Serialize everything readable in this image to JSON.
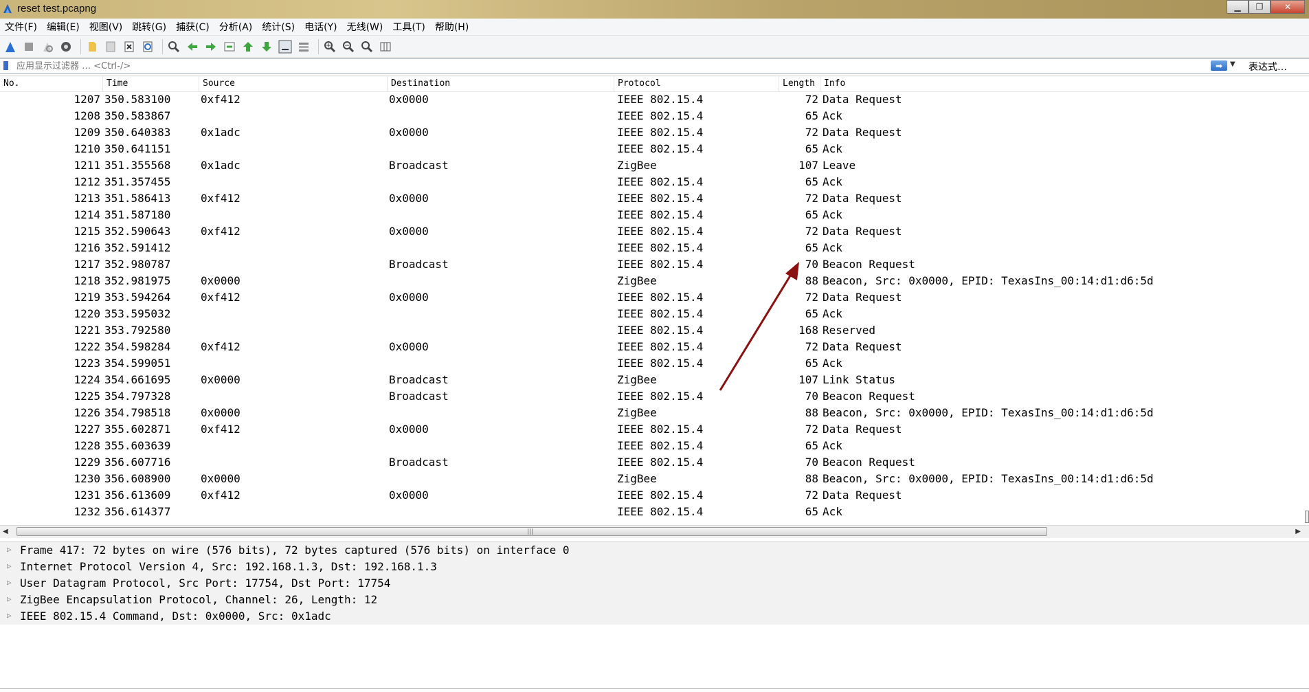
{
  "window": {
    "title": "reset test.pcapng"
  },
  "menu": [
    "文件(F)",
    "编辑(E)",
    "视图(V)",
    "跳转(G)",
    "捕获(C)",
    "分析(A)",
    "统计(S)",
    "电话(Y)",
    "无线(W)",
    "工具(T)",
    "帮助(H)"
  ],
  "filter": {
    "placeholder": "应用显示过滤器 … <Ctrl-/>",
    "expression_label": "表达式…"
  },
  "columns": {
    "no": "No.",
    "time": "Time",
    "source": "Source",
    "destination": "Destination",
    "protocol": "Protocol",
    "length": "Length",
    "info": "Info"
  },
  "packets": [
    {
      "no": "1207",
      "time": "350.583100",
      "src": "0xf412",
      "dst": "0x0000",
      "proto": "IEEE 802.15.4",
      "len": "72",
      "info": "Data Request"
    },
    {
      "no": "1208",
      "time": "350.583867",
      "src": "",
      "dst": "",
      "proto": "IEEE 802.15.4",
      "len": "65",
      "info": "Ack"
    },
    {
      "no": "1209",
      "time": "350.640383",
      "src": "0x1adc",
      "dst": "0x0000",
      "proto": "IEEE 802.15.4",
      "len": "72",
      "info": "Data Request"
    },
    {
      "no": "1210",
      "time": "350.641151",
      "src": "",
      "dst": "",
      "proto": "IEEE 802.15.4",
      "len": "65",
      "info": "Ack"
    },
    {
      "no": "1211",
      "time": "351.355568",
      "src": "0x1adc",
      "dst": "Broadcast",
      "proto": "ZigBee",
      "len": "107",
      "info": "Leave"
    },
    {
      "no": "1212",
      "time": "351.357455",
      "src": "",
      "dst": "",
      "proto": "IEEE 802.15.4",
      "len": "65",
      "info": "Ack"
    },
    {
      "no": "1213",
      "time": "351.586413",
      "src": "0xf412",
      "dst": "0x0000",
      "proto": "IEEE 802.15.4",
      "len": "72",
      "info": "Data Request"
    },
    {
      "no": "1214",
      "time": "351.587180",
      "src": "",
      "dst": "",
      "proto": "IEEE 802.15.4",
      "len": "65",
      "info": "Ack"
    },
    {
      "no": "1215",
      "time": "352.590643",
      "src": "0xf412",
      "dst": "0x0000",
      "proto": "IEEE 802.15.4",
      "len": "72",
      "info": "Data Request"
    },
    {
      "no": "1216",
      "time": "352.591412",
      "src": "",
      "dst": "",
      "proto": "IEEE 802.15.4",
      "len": "65",
      "info": "Ack"
    },
    {
      "no": "1217",
      "time": "352.980787",
      "src": "",
      "dst": "Broadcast",
      "proto": "IEEE 802.15.4",
      "len": "70",
      "info": "Beacon Request"
    },
    {
      "no": "1218",
      "time": "352.981975",
      "src": "0x0000",
      "dst": "",
      "proto": "ZigBee",
      "len": "88",
      "info": "Beacon, Src: 0x0000, EPID: TexasIns_00:14:d1:d6:5d"
    },
    {
      "no": "1219",
      "time": "353.594264",
      "src": "0xf412",
      "dst": "0x0000",
      "proto": "IEEE 802.15.4",
      "len": "72",
      "info": "Data Request"
    },
    {
      "no": "1220",
      "time": "353.595032",
      "src": "",
      "dst": "",
      "proto": "IEEE 802.15.4",
      "len": "65",
      "info": "Ack"
    },
    {
      "no": "1221",
      "time": "353.792580",
      "src": "",
      "dst": "",
      "proto": "IEEE 802.15.4",
      "len": "168",
      "info": "Reserved"
    },
    {
      "no": "1222",
      "time": "354.598284",
      "src": "0xf412",
      "dst": "0x0000",
      "proto": "IEEE 802.15.4",
      "len": "72",
      "info": "Data Request"
    },
    {
      "no": "1223",
      "time": "354.599051",
      "src": "",
      "dst": "",
      "proto": "IEEE 802.15.4",
      "len": "65",
      "info": "Ack"
    },
    {
      "no": "1224",
      "time": "354.661695",
      "src": "0x0000",
      "dst": "Broadcast",
      "proto": "ZigBee",
      "len": "107",
      "info": "Link Status"
    },
    {
      "no": "1225",
      "time": "354.797328",
      "src": "",
      "dst": "Broadcast",
      "proto": "IEEE 802.15.4",
      "len": "70",
      "info": "Beacon Request"
    },
    {
      "no": "1226",
      "time": "354.798518",
      "src": "0x0000",
      "dst": "",
      "proto": "ZigBee",
      "len": "88",
      "info": "Beacon, Src: 0x0000, EPID: TexasIns_00:14:d1:d6:5d"
    },
    {
      "no": "1227",
      "time": "355.602871",
      "src": "0xf412",
      "dst": "0x0000",
      "proto": "IEEE 802.15.4",
      "len": "72",
      "info": "Data Request"
    },
    {
      "no": "1228",
      "time": "355.603639",
      "src": "",
      "dst": "",
      "proto": "IEEE 802.15.4",
      "len": "65",
      "info": "Ack"
    },
    {
      "no": "1229",
      "time": "356.607716",
      "src": "",
      "dst": "Broadcast",
      "proto": "IEEE 802.15.4",
      "len": "70",
      "info": "Beacon Request"
    },
    {
      "no": "1230",
      "time": "356.608900",
      "src": "0x0000",
      "dst": "",
      "proto": "ZigBee",
      "len": "88",
      "info": "Beacon, Src: 0x0000, EPID: TexasIns_00:14:d1:d6:5d"
    },
    {
      "no": "1231",
      "time": "356.613609",
      "src": "0xf412",
      "dst": "0x0000",
      "proto": "IEEE 802.15.4",
      "len": "72",
      "info": "Data Request"
    },
    {
      "no": "1232",
      "time": "356.614377",
      "src": "",
      "dst": "",
      "proto": "IEEE 802.15.4",
      "len": "65",
      "info": "Ack"
    }
  ],
  "details": [
    "Frame 417: 72 bytes on wire (576 bits), 72 bytes captured (576 bits) on interface 0",
    "Internet Protocol Version 4, Src: 192.168.1.3, Dst: 192.168.1.3",
    "User Datagram Protocol, Src Port: 17754, Dst Port: 17754",
    "ZigBee Encapsulation Protocol, Channel: 26, Length: 12",
    "IEEE 802.15.4 Command, Dst: 0x0000, Src: 0x1adc"
  ],
  "colors": {
    "annotation_arrow": "#8b1010",
    "filter_apply": "#2f6fc5"
  }
}
